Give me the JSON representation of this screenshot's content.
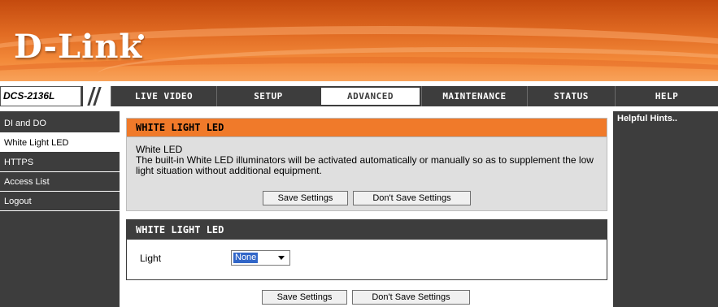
{
  "brand": {
    "logo_text": "D-Link",
    "model": "DCS-2136L"
  },
  "nav": {
    "tabs": [
      {
        "label": "LIVE VIDEO"
      },
      {
        "label": "SETUP"
      },
      {
        "label": "ADVANCED",
        "active": true
      },
      {
        "label": "MAINTENANCE"
      },
      {
        "label": "STATUS"
      },
      {
        "label": "HELP"
      }
    ]
  },
  "sidebar": {
    "items": [
      {
        "label": "DI and DO"
      },
      {
        "label": "White Light LED",
        "active": true
      },
      {
        "label": "HTTPS"
      },
      {
        "label": "Access List"
      },
      {
        "label": "Logout"
      }
    ]
  },
  "info_panel": {
    "title": "WHITE LIGHT LED",
    "subtitle": "White LED",
    "description": "The built-in White LED illuminators will be activated automatically or manually so as to supplement the low light situation without additional equipment.",
    "save_label": "Save Settings",
    "dont_save_label": "Don't Save Settings"
  },
  "settings_panel": {
    "title": "WHITE LIGHT LED",
    "light_label": "Light",
    "light_value": "None"
  },
  "bottom": {
    "save_label": "Save Settings",
    "dont_save_label": "Don't Save Settings"
  },
  "hints": {
    "title": "Helpful Hints.."
  },
  "colors": {
    "header_orange": "#e06a22",
    "panel_header_orange": "#f07a2a",
    "nav_dark": "#3d3d3d",
    "panel_gray": "#dfdfdf",
    "select_highlight": "#3166c8"
  },
  "icons": {
    "dropdown": "chevron-down-icon"
  }
}
